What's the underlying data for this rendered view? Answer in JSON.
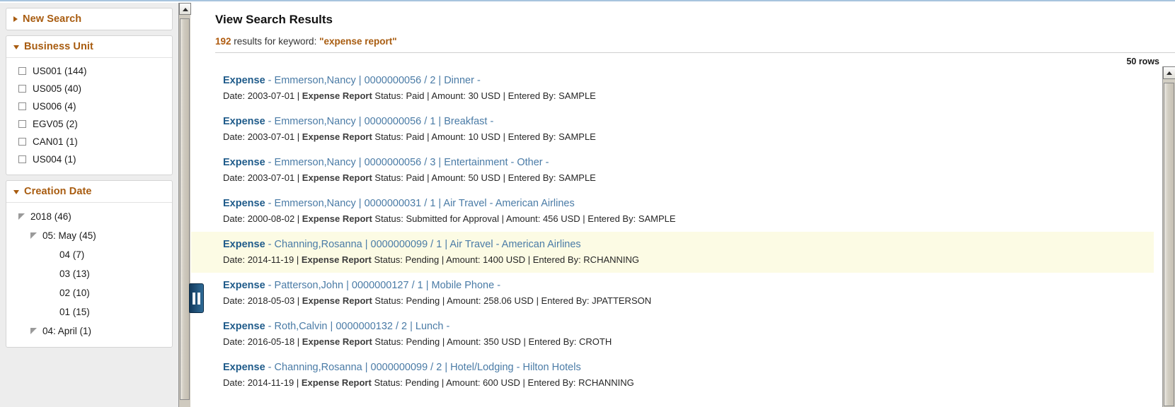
{
  "sidebar": {
    "new_search": {
      "label": "New Search",
      "icon": "triangle-right-icon"
    },
    "business_unit": {
      "title": "Business Unit",
      "icon": "triangle-down-icon",
      "options": [
        {
          "label": "US001 (144)"
        },
        {
          "label": "US005 (40)"
        },
        {
          "label": "US006 (4)"
        },
        {
          "label": "EGV05 (2)"
        },
        {
          "label": "CAN01 (1)"
        },
        {
          "label": "US004 (1)"
        }
      ]
    },
    "creation_date": {
      "title": "Creation Date",
      "icon": "triangle-down-icon",
      "nodes": [
        {
          "label": "2018 (46)",
          "level": 0,
          "expandable": true
        },
        {
          "label": "05: May (45)",
          "level": 1,
          "expandable": true
        },
        {
          "label": "04 (7)",
          "level": 2,
          "expandable": false
        },
        {
          "label": "03 (13)",
          "level": 2,
          "expandable": false
        },
        {
          "label": "02 (10)",
          "level": 2,
          "expandable": false
        },
        {
          "label": "01 (15)",
          "level": 2,
          "expandable": false
        },
        {
          "label": "04: April (1)",
          "level": 1,
          "expandable": true
        }
      ]
    }
  },
  "collapse_handle": {
    "icon": "pause-bars-icon"
  },
  "main": {
    "title": "View Search Results",
    "summary": {
      "count": "192",
      "middle": " results for keyword: ",
      "keyword": "\"expense report\""
    },
    "rows_label": "50 rows",
    "results": [
      {
        "type": "Expense",
        "title_rest": " - Emmerson,Nancy | 0000000056 / 2 | Dinner -",
        "date_label": "Date: ",
        "date": "2003-07-01",
        "doc_type": "Expense Report",
        "status_label": " Status: ",
        "status": "Paid",
        "amount_label": " | Amount: ",
        "amount": "30 USD",
        "entered_label": " | Entered By: ",
        "entered_by": "SAMPLE",
        "highlighted": false,
        "action_icon": "chevron-down-circle-icon"
      },
      {
        "type": "Expense",
        "title_rest": " - Emmerson,Nancy | 0000000056 / 1 | Breakfast -",
        "date_label": "Date: ",
        "date": "2003-07-01",
        "doc_type": "Expense Report",
        "status_label": " Status: ",
        "status": "Paid",
        "amount_label": " | Amount: ",
        "amount": "10 USD",
        "entered_label": " | Entered By: ",
        "entered_by": "SAMPLE",
        "highlighted": false,
        "action_icon": "chevron-down-circle-icon"
      },
      {
        "type": "Expense",
        "title_rest": " - Emmerson,Nancy | 0000000056 / 3 | Entertainment - Other -",
        "date_label": "Date: ",
        "date": "2003-07-01",
        "doc_type": "Expense Report",
        "status_label": " Status: ",
        "status": "Paid",
        "amount_label": " | Amount: ",
        "amount": "50 USD",
        "entered_label": " | Entered By: ",
        "entered_by": "SAMPLE",
        "highlighted": false,
        "action_icon": "chevron-down-circle-icon"
      },
      {
        "type": "Expense",
        "title_rest": " - Emmerson,Nancy | 0000000031 / 1 | Air Travel - American Airlines",
        "date_label": "Date: ",
        "date": "2000-08-02",
        "doc_type": "Expense Report",
        "status_label": " Status: ",
        "status": "Submitted for Approval",
        "amount_label": " | Amount: ",
        "amount": "456 USD",
        "entered_label": " | Entered By: ",
        "entered_by": "SAMPLE",
        "highlighted": false,
        "action_icon": "chevron-down-circle-icon"
      },
      {
        "type": "Expense",
        "title_rest": " - Channing,Rosanna | 0000000099 / 1 | Air Travel - American Airlines",
        "date_label": "Date: ",
        "date": "2014-11-19",
        "doc_type": "Expense Report",
        "status_label": " Status: ",
        "status": "Pending",
        "amount_label": " | Amount: ",
        "amount": "1400 USD",
        "entered_label": " | Entered By: ",
        "entered_by": "RCHANNING",
        "highlighted": true,
        "action_icon": "chevron-down-circle-icon"
      },
      {
        "type": "Expense",
        "title_rest": " - Patterson,John | 0000000127 / 1 | Mobile Phone -",
        "date_label": "Date: ",
        "date": "2018-05-03",
        "doc_type": "Expense Report",
        "status_label": " Status: ",
        "status": "Pending",
        "amount_label": " | Amount: ",
        "amount": "258.06 USD",
        "entered_label": " | Entered By: ",
        "entered_by": "JPATTERSON",
        "highlighted": false,
        "action_icon": "chevron-down-circle-icon"
      },
      {
        "type": "Expense",
        "title_rest": " - Roth,Calvin | 0000000132 / 2 | Lunch -",
        "date_label": "Date: ",
        "date": "2016-05-18",
        "doc_type": "Expense Report",
        "status_label": " Status: ",
        "status": "Pending",
        "amount_label": " | Amount: ",
        "amount": "350 USD",
        "entered_label": " | Entered By: ",
        "entered_by": "CROTH",
        "highlighted": false,
        "action_icon": "chevron-down-circle-icon"
      },
      {
        "type": "Expense",
        "title_rest": " - Channing,Rosanna | 0000000099 / 2 | Hotel/Lodging - Hilton Hotels",
        "date_label": "Date: ",
        "date": "2014-11-19",
        "doc_type": "Expense Report",
        "status_label": " Status: ",
        "status": "Pending",
        "amount_label": " | Amount: ",
        "amount": "600 USD",
        "entered_label": " | Entered By: ",
        "entered_by": "RCHANNING",
        "highlighted": false,
        "action_icon": "chevron-down-circle-icon"
      }
    ]
  },
  "scrollbars": {
    "left": {
      "up_icon": "scroll-up-arrow-icon"
    },
    "right": {
      "up_icon": "scroll-up-arrow-icon"
    }
  },
  "colors": {
    "accent_orange": "#a85c10",
    "link_blue": "#4a7ba6",
    "link_blue_strong": "#1f5b8a",
    "highlight_row": "#fcfbe4",
    "action_green": "#7fe0c8"
  }
}
